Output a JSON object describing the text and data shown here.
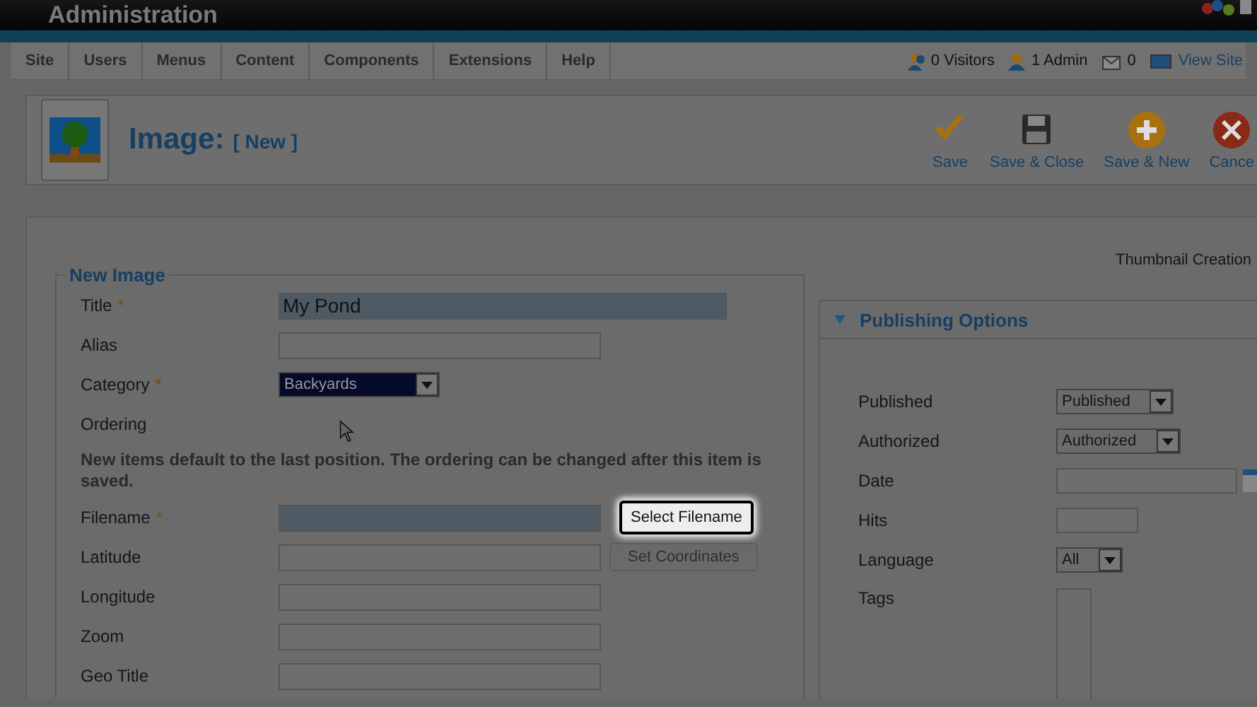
{
  "header": {
    "title": "Administration"
  },
  "menu": {
    "items": [
      "Site",
      "Users",
      "Menus",
      "Content",
      "Components",
      "Extensions",
      "Help"
    ],
    "status": [
      {
        "kind": "visitors",
        "text": "0 Visitors"
      },
      {
        "kind": "admin",
        "text": "1 Admin"
      },
      {
        "kind": "messages",
        "text": "0"
      },
      {
        "kind": "view",
        "text": "View Site"
      }
    ]
  },
  "toolbar": {
    "title": "Image:",
    "subtitle": "[ New ]",
    "buttons": [
      {
        "kind": "save",
        "label": "Save"
      },
      {
        "kind": "save_close",
        "label": "Save & Close"
      },
      {
        "kind": "save_new",
        "label": "Save & New"
      },
      {
        "kind": "cancel",
        "label": "Cance"
      }
    ]
  },
  "form": {
    "legend": "New Image",
    "fields": [
      {
        "kind": "text",
        "label": "Title",
        "required_mark": "*",
        "value": "My Pond",
        "highlighted": true,
        "wide": true
      },
      {
        "kind": "text",
        "label": "Alias",
        "highlighted": false,
        "wide": false
      },
      {
        "kind": "select",
        "label": "Category",
        "required_mark": "*",
        "value": "Backyards"
      },
      {
        "kind": "note",
        "label": "Ordering",
        "note": "New items default to the last position. The ordering can be changed after this item is saved."
      },
      {
        "kind": "text",
        "label": "Filename",
        "required_mark": "*",
        "highlighted": true,
        "wide": false,
        "button": {
          "label": "Select Filename",
          "highlighted": true
        }
      },
      {
        "kind": "text",
        "label": "Latitude",
        "highlighted": false,
        "wide": false,
        "button": {
          "label": "Set Coordinates",
          "highlighted": false
        }
      },
      {
        "kind": "text",
        "label": "Longitude",
        "highlighted": false,
        "wide": false
      },
      {
        "kind": "text",
        "label": "Zoom",
        "highlighted": false,
        "wide": false
      },
      {
        "kind": "text",
        "label": "Geo Title",
        "highlighted": false,
        "wide": false
      }
    ]
  },
  "thumbnail_label": "Thumbnail Creation",
  "publishing": {
    "title": "Publishing Options",
    "expanded": true,
    "fields": [
      {
        "kind": "select",
        "label": "Published",
        "value": "Published"
      },
      {
        "kind": "select",
        "label": "Authorized",
        "value": "Authorized"
      },
      {
        "kind": "date",
        "label": "Date"
      },
      {
        "kind": "short",
        "label": "Hits"
      },
      {
        "kind": "select",
        "label": "Language",
        "value": "All"
      },
      {
        "kind": "list",
        "label": "Tags"
      }
    ]
  }
}
